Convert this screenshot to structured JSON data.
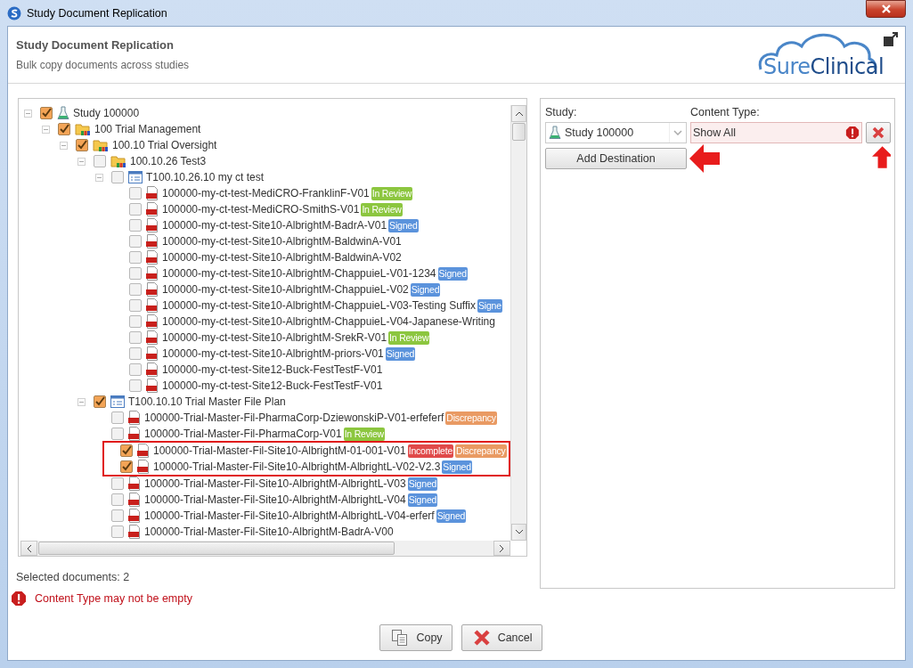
{
  "window": {
    "title": "Study Document Replication"
  },
  "header": {
    "title": "Study Document Replication",
    "subtitle": "Bulk copy documents across studies",
    "logo_first": "Sure",
    "logo_second": "Clinical"
  },
  "tree": [
    {
      "kind": "study",
      "label": "Study 100000",
      "checked": true,
      "expanded": true,
      "children": [
        {
          "kind": "folder",
          "label": "100 Trial Management",
          "checked": true,
          "expanded": true,
          "children": [
            {
              "kind": "folder",
              "label": "100.10 Trial Oversight",
              "checked": true,
              "expanded": true,
              "children": [
                {
                  "kind": "folder",
                  "label": "100.10.26 Test3",
                  "checked": false,
                  "expanded": true,
                  "children": [
                    {
                      "kind": "plan",
                      "label": "T100.10.26.10 my ct test",
                      "checked": false,
                      "expanded": true,
                      "children": [
                        {
                          "kind": "document",
                          "label": "100000-my-ct-test-MediCRO-FranklinF-V01",
                          "checked": false,
                          "highlighted": false,
                          "badges": [
                            {
                              "text": "In Review",
                              "color": "#8cc63f"
                            }
                          ]
                        },
                        {
                          "kind": "document",
                          "label": "100000-my-ct-test-MediCRO-SmithS-V01",
                          "checked": false,
                          "highlighted": false,
                          "badges": [
                            {
                              "text": "In Review",
                              "color": "#8cc63f"
                            }
                          ]
                        },
                        {
                          "kind": "document",
                          "label": "100000-my-ct-test-Site10-AlbrightM-BadrA-V01",
                          "checked": false,
                          "highlighted": false,
                          "badges": [
                            {
                              "text": "Signed",
                              "color": "#5b93dc"
                            }
                          ]
                        },
                        {
                          "kind": "document",
                          "label": "100000-my-ct-test-Site10-AlbrightM-BaldwinA-V01",
                          "checked": false,
                          "highlighted": false
                        },
                        {
                          "kind": "document",
                          "label": "100000-my-ct-test-Site10-AlbrightM-BaldwinA-V02",
                          "checked": false,
                          "highlighted": false
                        },
                        {
                          "kind": "document",
                          "label": "100000-my-ct-test-Site10-AlbrightM-ChappuieL-V01-1234",
                          "checked": false,
                          "highlighted": false,
                          "badges": [
                            {
                              "text": "Signed",
                              "color": "#5b93dc"
                            }
                          ]
                        },
                        {
                          "kind": "document",
                          "label": "100000-my-ct-test-Site10-AlbrightM-ChappuieL-V02",
                          "checked": false,
                          "highlighted": false,
                          "badges": [
                            {
                              "text": "Signed",
                              "color": "#5b93dc"
                            }
                          ]
                        },
                        {
                          "kind": "document",
                          "label": "100000-my-ct-test-Site10-AlbrightM-ChappuieL-V03-Testing Suffix",
                          "checked": false,
                          "highlighted": false,
                          "badges": [
                            {
                              "text": "Signe",
                              "color": "#5b93dc"
                            }
                          ]
                        },
                        {
                          "kind": "document",
                          "label": "100000-my-ct-test-Site10-AlbrightM-ChappuieL-V04-Japanese-Writing",
                          "checked": false,
                          "highlighted": false
                        },
                        {
                          "kind": "document",
                          "label": "100000-my-ct-test-Site10-AlbrightM-SrekR-V01",
                          "checked": false,
                          "highlighted": false,
                          "badges": [
                            {
                              "text": "In Review",
                              "color": "#8cc63f"
                            }
                          ]
                        },
                        {
                          "kind": "document",
                          "label": "100000-my-ct-test-Site10-AlbrightM-priors-V01",
                          "checked": false,
                          "highlighted": false,
                          "badges": [
                            {
                              "text": "Signed",
                              "color": "#5b93dc"
                            }
                          ]
                        },
                        {
                          "kind": "document",
                          "label": "100000-my-ct-test-Site12-Buck-FestTestF-V01",
                          "checked": false,
                          "highlighted": false
                        },
                        {
                          "kind": "document",
                          "label": "100000-my-ct-test-Site12-Buck-FestTestF-V01",
                          "checked": false,
                          "highlighted": false
                        }
                      ]
                    }
                  ]
                },
                {
                  "kind": "plan",
                  "label": "T100.10.10 Trial Master File Plan",
                  "checked": true,
                  "expanded": true,
                  "children": [
                    {
                      "kind": "document",
                      "label": "100000-Trial-Master-Fil-PharmaCorp-DziewonskiP-V01-erfeferf",
                      "checked": false,
                      "highlighted": false,
                      "badges": [
                        {
                          "text": "Discrepancy",
                          "color": "#e99a63"
                        }
                      ]
                    },
                    {
                      "kind": "document",
                      "label": "100000-Trial-Master-Fil-PharmaCorp-V01",
                      "checked": false,
                      "highlighted": false,
                      "badges": [
                        {
                          "text": "In Review",
                          "color": "#8cc63f"
                        }
                      ]
                    },
                    {
                      "kind": "document",
                      "label": "100000-Trial-Master-Fil-Site10-AlbrightM-01-001-V01",
                      "checked": true,
                      "highlighted": true,
                      "badges": [
                        {
                          "text": "Incomplete",
                          "color": "#e04a4a"
                        },
                        {
                          "text": "Discrepancy",
                          "color": "#e99a63"
                        }
                      ]
                    },
                    {
                      "kind": "document",
                      "label": "100000-Trial-Master-Fil-Site10-AlbrightM-AlbrightL-V02-V2.3",
                      "checked": true,
                      "highlighted": true,
                      "badges": [
                        {
                          "text": "Signed",
                          "color": "#5b93dc"
                        }
                      ]
                    },
                    {
                      "kind": "document",
                      "label": "100000-Trial-Master-Fil-Site10-AlbrightM-AlbrightL-V03",
                      "checked": false,
                      "highlighted": false,
                      "badges": [
                        {
                          "text": "Signed",
                          "color": "#5b93dc"
                        }
                      ]
                    },
                    {
                      "kind": "document",
                      "label": "100000-Trial-Master-Fil-Site10-AlbrightM-AlbrightL-V04",
                      "checked": false,
                      "highlighted": false,
                      "badges": [
                        {
                          "text": "Signed",
                          "color": "#5b93dc"
                        }
                      ]
                    },
                    {
                      "kind": "document",
                      "label": "100000-Trial-Master-Fil-Site10-AlbrightM-AlbrightL-V04-erferf",
                      "checked": false,
                      "highlighted": false,
                      "badges": [
                        {
                          "text": "Signed",
                          "color": "#5b93dc"
                        }
                      ]
                    },
                    {
                      "kind": "document",
                      "label": "100000-Trial-Master-Fil-Site10-AlbrightM-BadrA-V00",
                      "checked": false,
                      "highlighted": false
                    }
                  ]
                }
              ]
            }
          ]
        }
      ]
    }
  ],
  "selected_count": "Selected documents: 2",
  "error": "Content Type may not be empty",
  "destination": {
    "study_label": "Study:",
    "study_value": "Study 100000",
    "content_type_label": "Content Type:",
    "content_type_value": "Show All",
    "content_type_invalid": true,
    "add_button": {
      "label": "Add Destination",
      "pointer_arrow": true
    },
    "remove_button": {
      "pointer_arrow": true
    }
  },
  "buttons": [
    {
      "kind": "copy",
      "label": "Copy"
    },
    {
      "kind": "cancel",
      "label": "Cancel"
    }
  ]
}
